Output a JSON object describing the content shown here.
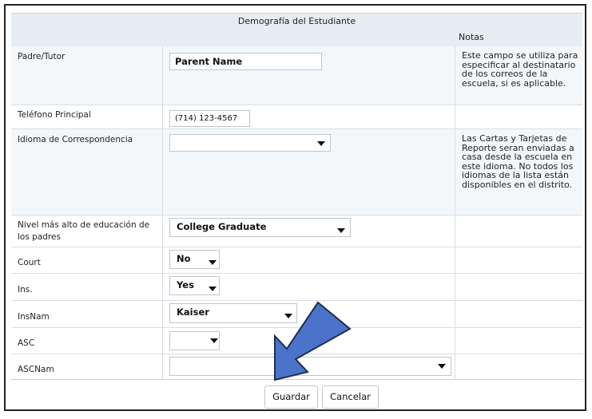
{
  "header": {
    "title": "Demografía del Estudiante",
    "notes_label": "Notas"
  },
  "rows": {
    "padre": {
      "label": "Padre/Tutor",
      "value": "Parent Name",
      "note": "Este campo se utiliza para especificar al destinatario de los correos de la escuela, si es aplicable."
    },
    "telefono": {
      "label": "Teléfono Principal",
      "value": "(714) 123-4567"
    },
    "idioma": {
      "label": "Idioma de Correspondencia",
      "value": "",
      "note": "Las Cartas y Tarjetas de Reporte seran enviadas a casa desde la escuela en este idioma. No todos los idiomas de la lista están disponibles en el distrito."
    },
    "nivel": {
      "label": "Nivel más alto de educación de los padres",
      "value": "College Graduate"
    },
    "court": {
      "label": "Court",
      "value": "No"
    },
    "ins": {
      "label": "Ins.",
      "value": "Yes"
    },
    "insnam": {
      "label": "InsNam",
      "value": "Kaiser"
    },
    "asc": {
      "label": "ASC",
      "value": ""
    },
    "ascnam": {
      "label": "ASCNam",
      "value": ""
    }
  },
  "buttons": {
    "save": "Guardar",
    "cancel": "Cancelar"
  },
  "colors": {
    "header_bg": "#e6edf4",
    "arrow_fill": "#4a73c9",
    "arrow_stroke": "#1e2e50"
  }
}
